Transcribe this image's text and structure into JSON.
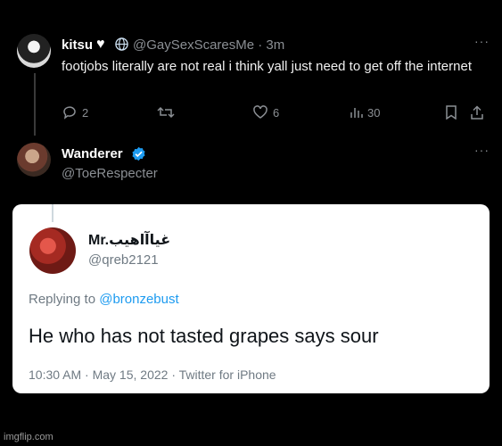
{
  "tweet": {
    "name": "kitsu",
    "name_emoji": "♥",
    "handle": "@GaySexScaresMe · 3m",
    "more": "···",
    "text": "footjobs literally are not real i think yall just need to get off the internet",
    "actions": {
      "reply_count": "2",
      "retweet_count": "",
      "like_count": "6",
      "view_count": "30"
    }
  },
  "reply": {
    "name": "Wanderer",
    "handle": "@ToeRespecter",
    "more": "···",
    "verified_color": "#1d9bf0"
  },
  "quoted": {
    "name": "Mr.غياآاهيب",
    "handle": "@qreb2121",
    "replying_prefix": "Replying to ",
    "replying_handle": "@bronzebust",
    "text": "He who has not tasted grapes says sour",
    "meta": "10:30 AM · May 15, 2022 · Twitter for iPhone"
  },
  "watermark": "imgflip.com"
}
